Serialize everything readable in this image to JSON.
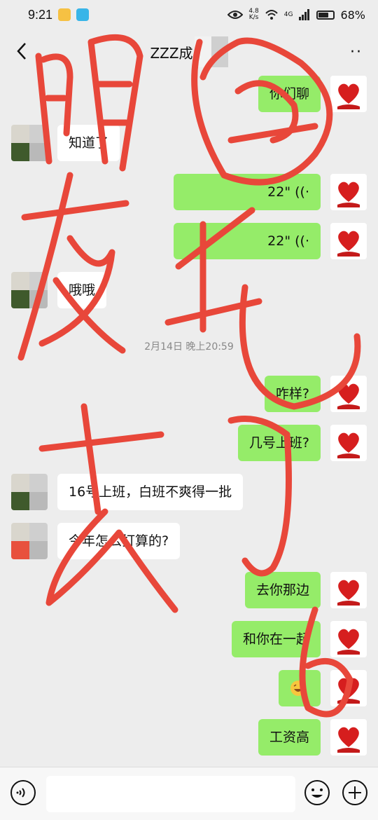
{
  "status_bar": {
    "time": "9:21",
    "net_speed_value": "4.8",
    "net_speed_unit": "K/s",
    "network": "4G",
    "battery": "68%",
    "battery_level": 0.68
  },
  "header": {
    "title": "ZZZ成"
  },
  "messages": [
    {
      "side": "right",
      "type": "text",
      "text": "你们聊"
    },
    {
      "side": "left",
      "type": "text",
      "text": "知道了"
    },
    {
      "side": "right",
      "type": "voice",
      "text": "22\""
    },
    {
      "side": "right",
      "type": "voice",
      "text": "22\""
    },
    {
      "side": "left",
      "type": "text",
      "text": "哦哦"
    },
    {
      "side": "system",
      "type": "time",
      "text": "2月14日 晚上20:59"
    },
    {
      "side": "right",
      "type": "text",
      "text": "咋样?"
    },
    {
      "side": "right",
      "type": "text",
      "text": "几号上班?"
    },
    {
      "side": "left",
      "type": "text",
      "text": "16号上班，白班不爽得一批"
    },
    {
      "side": "left",
      "type": "text",
      "text": "今年怎么打算的?"
    },
    {
      "side": "right",
      "type": "text",
      "text": "去你那边"
    },
    {
      "side": "right",
      "type": "text",
      "text": "和你在一起"
    },
    {
      "side": "right",
      "type": "emoji",
      "text": ""
    },
    {
      "side": "right",
      "type": "text",
      "text": "工资高"
    }
  ],
  "input_bar": {
    "voice_icon": "voice-toggle-icon",
    "emoji_icon": "emoji-icon",
    "plus_icon": "plus-icon"
  },
  "colors": {
    "sent_bubble": "#95ec69",
    "received_bubble": "#ffffff",
    "chat_background": "#ededed",
    "annotation_red": "#e8473a"
  }
}
